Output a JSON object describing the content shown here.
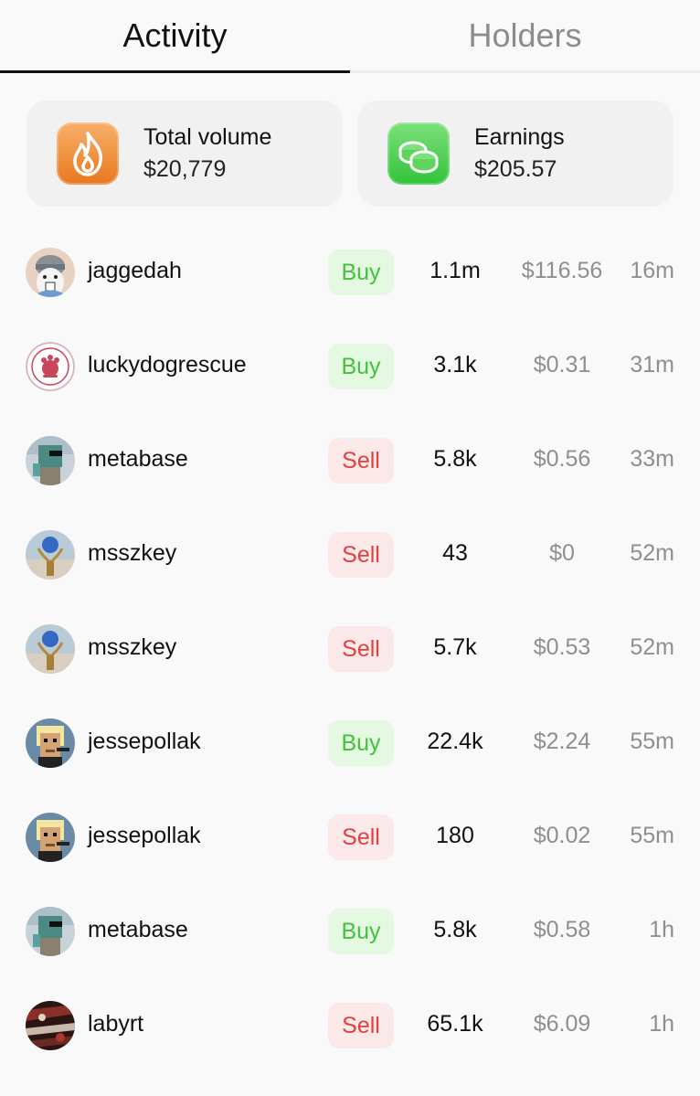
{
  "tabs": [
    {
      "label": "Activity",
      "active": true
    },
    {
      "label": "Holders",
      "active": false
    }
  ],
  "stats": {
    "volume": {
      "label": "Total volume",
      "value": "$20,779",
      "icon": "flame-icon"
    },
    "earnings": {
      "label": "Earnings",
      "value": "$205.57",
      "icon": "coins-icon"
    }
  },
  "colors": {
    "buy_text": "#43c23c",
    "buy_bg": "#e5f8e2",
    "sell_text": "#e0413f",
    "sell_bg": "#fbe9e9",
    "volume_icon": "#e8781e",
    "earnings_icon": "#31c33a"
  },
  "activity": [
    {
      "user": "jaggedah",
      "type": "Buy",
      "amount": "1.1m",
      "price": "$116.56",
      "time": "16m"
    },
    {
      "user": "luckydogrescue",
      "type": "Buy",
      "amount": "3.1k",
      "price": "$0.31",
      "time": "31m"
    },
    {
      "user": "metabase",
      "type": "Sell",
      "amount": "5.8k",
      "price": "$0.56",
      "time": "33m"
    },
    {
      "user": "msszkey",
      "type": "Sell",
      "amount": "43",
      "price": "$0",
      "time": "52m"
    },
    {
      "user": "msszkey",
      "type": "Sell",
      "amount": "5.7k",
      "price": "$0.53",
      "time": "52m"
    },
    {
      "user": "jessepollak",
      "type": "Buy",
      "amount": "22.4k",
      "price": "$2.24",
      "time": "55m"
    },
    {
      "user": "jessepollak",
      "type": "Sell",
      "amount": "180",
      "price": "$0.02",
      "time": "55m"
    },
    {
      "user": "metabase",
      "type": "Buy",
      "amount": "5.8k",
      "price": "$0.58",
      "time": "1h"
    },
    {
      "user": "labyrt",
      "type": "Sell",
      "amount": "65.1k",
      "price": "$6.09",
      "time": "1h"
    }
  ]
}
